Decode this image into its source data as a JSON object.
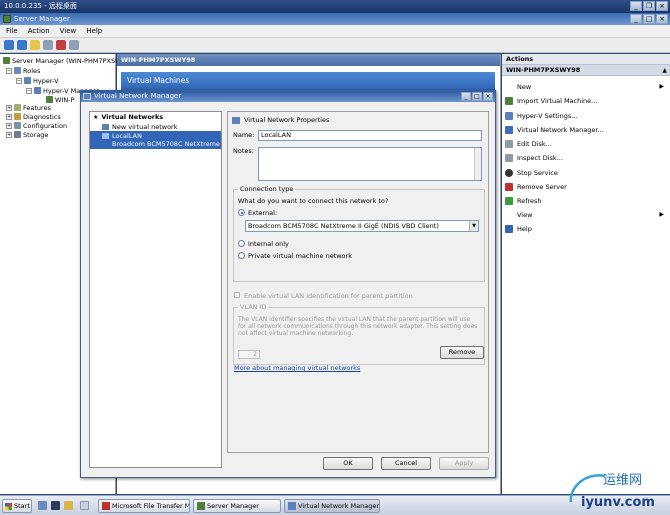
{
  "rdp": {
    "title": "10.0.0.235 - 远程桌面"
  },
  "window": {
    "title": "Server Manager"
  },
  "menu": [
    "File",
    "Action",
    "View",
    "Help"
  ],
  "tree": {
    "items": [
      "Server Manager (WIN-PHM7PXSWY",
      "Roles",
      "Hyper-V",
      "Hyper-V Manager",
      "WIN-P",
      "Features",
      "Diagnostics",
      "Configuration",
      "Storage"
    ]
  },
  "center": {
    "header": "WIN-PHM7PXSWY98",
    "band": "Virtual Machines"
  },
  "actions": {
    "header": "Actions",
    "subheader": "WIN-PHM7PXSWY98",
    "items": [
      "New",
      "Import Virtual Machine...",
      "Hyper-V Settings...",
      "Virtual Network Manager...",
      "Edit Disk...",
      "Inspect Disk...",
      "Stop Service",
      "Remove Server",
      "Refresh",
      "View",
      "Help"
    ]
  },
  "dialog": {
    "title": "Virtual Network Manager",
    "list": {
      "header": "Virtual Networks",
      "new_item": "New virtual network",
      "selected_name": "LocalLAN",
      "selected_adapter": "Broadcom BCM5708C NetXtreme II..."
    },
    "props": {
      "header": "Virtual Network Properties",
      "name_label": "Name:",
      "name_value": "LocalLAN",
      "notes_label": "Notes:",
      "conn_group": "Connection type",
      "conn_question": "What do you want to connect this network to?",
      "external_label": "External:",
      "adapter_value": "Broadcom BCM5708C NetXtreme II GigE (NDIS VBD Client)",
      "internal_label": "Internal only",
      "private_label": "Private virtual machine network",
      "vlan_check": "Enable virtual LAN identification for parent partition",
      "vlan_group": "VLAN ID",
      "vlan_desc": "The VLAN identifier specifies the virtual LAN that the parent partition will use for all network communications through this network adapter. This setting does not affect virtual machine networking.",
      "vlan_value": "2",
      "remove_label": "Remove",
      "more_link": "More about managing virtual networks"
    },
    "ok": "OK",
    "cancel": "Cancel",
    "apply": "Apply"
  },
  "taskbar": {
    "start": "Start",
    "tasks": [
      "Microsoft File Transfer M...",
      "Server Manager",
      "Virtual Network Manager"
    ]
  },
  "watermark": {
    "brand": "运维网",
    "url": "iyunv.com"
  },
  "colors": {
    "accent": "#3165b8",
    "title": "#2b5aa4"
  }
}
